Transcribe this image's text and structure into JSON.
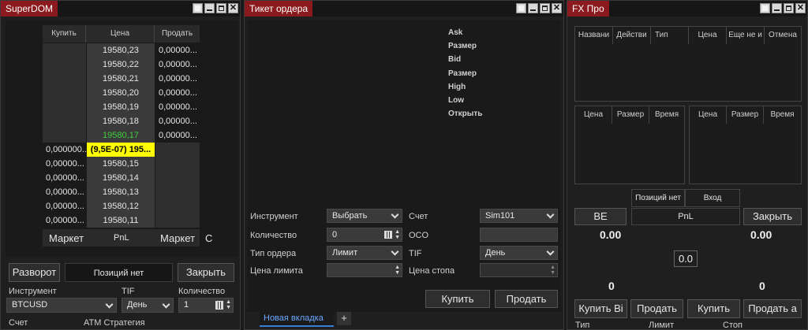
{
  "superdom": {
    "title": "SuperDOM",
    "headers": [
      "Купить",
      "Цена",
      "Продать"
    ],
    "rows": [
      {
        "buy": "",
        "price": "19580,23",
        "sell": "0,00000..."
      },
      {
        "buy": "",
        "price": "19580,22",
        "sell": "0,00000..."
      },
      {
        "buy": "",
        "price": "19580,21",
        "sell": "0,00000..."
      },
      {
        "buy": "",
        "price": "19580,20",
        "sell": "0,00000..."
      },
      {
        "buy": "",
        "price": "19580,19",
        "sell": "0,00000..."
      },
      {
        "buy": "",
        "price": "19580,18",
        "sell": "0,00000..."
      },
      {
        "buy": "",
        "price": "19580,17",
        "sell": "0,00000..."
      },
      {
        "buy": "0,000000...",
        "price": "(9,5E-07) 195...",
        "sell": ""
      },
      {
        "buy": "0,00000...",
        "price": "19580,15",
        "sell": ""
      },
      {
        "buy": "0,00000...",
        "price": "19580,14",
        "sell": ""
      },
      {
        "buy": "0,00000...",
        "price": "19580,13",
        "sell": ""
      },
      {
        "buy": "0,00000...",
        "price": "19580,12",
        "sell": ""
      },
      {
        "buy": "0,00000...",
        "price": "19580,11",
        "sell": ""
      }
    ],
    "footer": {
      "market_buy": "Маркет",
      "pnl": "PnL",
      "market_sell": "Маркет",
      "c": "C"
    },
    "reverse_button": "Разворот",
    "position_status": "Позиций нет",
    "close_button": "Закрыть",
    "instrument_label": "Инструмент",
    "tif_label": "TIF",
    "quantity_label": "Количество",
    "instrument_value": "BTCUSD",
    "tif_value": "День",
    "quantity_value": "1",
    "account_label": "Счет",
    "atm_label": "ATM Стратегия",
    "colors": {
      "last_price": "#3ccf3c",
      "highlight_bg": "#ffff00"
    }
  },
  "ticket": {
    "title": "Тикет ордера",
    "quote_labels": [
      "Ask",
      "Размер",
      "Bid",
      "Размер",
      "High",
      "Low",
      "Открыть"
    ],
    "instrument_label": "Инструмент",
    "instrument_value": "Выбрать",
    "account_label": "Счет",
    "account_value": "Sim101",
    "quantity_label": "Количество",
    "quantity_value": "0",
    "oco_label": "OCO",
    "order_type_label": "Тип ордера",
    "order_type_value": "Лимит",
    "tif_label": "TIF",
    "tif_value": "День",
    "limit_price_label": "Цена лимита",
    "stop_price_label": "Цена стопа",
    "buy_button": "Купить",
    "sell_button": "Продать",
    "new_tab": "Новая вкладка",
    "add_tab": "+"
  },
  "fxpro": {
    "title": "FX Про",
    "orders_headers": [
      "Названи",
      "Действи",
      "Тип",
      "Цена",
      "Еще не и",
      "Отмена"
    ],
    "bid_headers": [
      "Цена",
      "Размер",
      "Время"
    ],
    "ask_headers": [
      "Цена",
      "Размер",
      "Время"
    ],
    "position_label": "Позиций нет",
    "entry_label": "Вход",
    "be_button": "BE",
    "pnl_label": "PnL",
    "close_button": "Закрыть",
    "left_value": "0.00",
    "right_value": "0.00",
    "center_value": "0.0",
    "left_count": "0",
    "right_count": "0",
    "buttons": [
      "Купить Bi",
      "Продать",
      "Купить",
      "Продать а"
    ],
    "bottom_labels": [
      "Тип",
      "Лимит",
      "Стоп"
    ]
  }
}
